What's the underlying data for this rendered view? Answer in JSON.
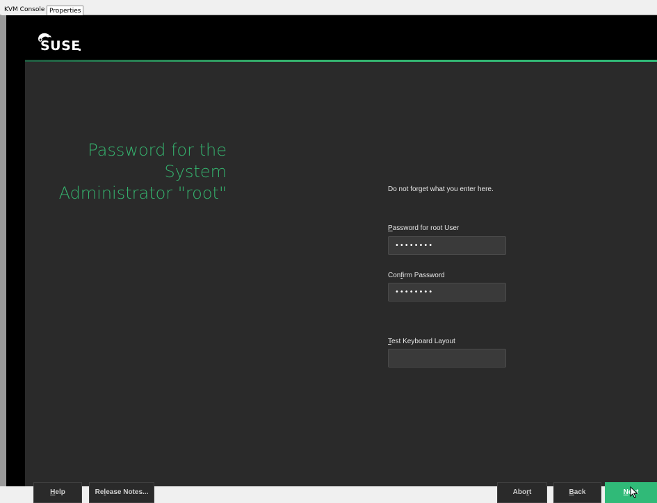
{
  "tabs": [
    {
      "label": "KVM Console"
    },
    {
      "label": "Properties"
    }
  ],
  "brand": {
    "logo_text": "SUSE",
    "accent_color": "#30ba78"
  },
  "page": {
    "title_lines": [
      "Password for the",
      "System",
      "Administrator \"root\""
    ]
  },
  "form": {
    "hint": "Do not forget what you enter here.",
    "password": {
      "label_key": "P",
      "label_rest": "assword for root User",
      "value": "••••••••"
    },
    "confirm": {
      "label_pre": "Con",
      "label_key": "f",
      "label_rest": "irm Password",
      "value": "••••••••"
    },
    "keyboard": {
      "label_key": "T",
      "label_rest": "est Keyboard Layout",
      "value": ""
    }
  },
  "buttons": {
    "help": {
      "key": "H",
      "rest": "elp"
    },
    "release_notes": {
      "pre": "Re",
      "key": "l",
      "rest": "ease Notes..."
    },
    "abort": {
      "pre": "Abo",
      "key": "r",
      "rest": "t"
    },
    "back": {
      "key": "B",
      "rest": "ack"
    },
    "next": {
      "key": "N",
      "rest": "ext"
    }
  }
}
